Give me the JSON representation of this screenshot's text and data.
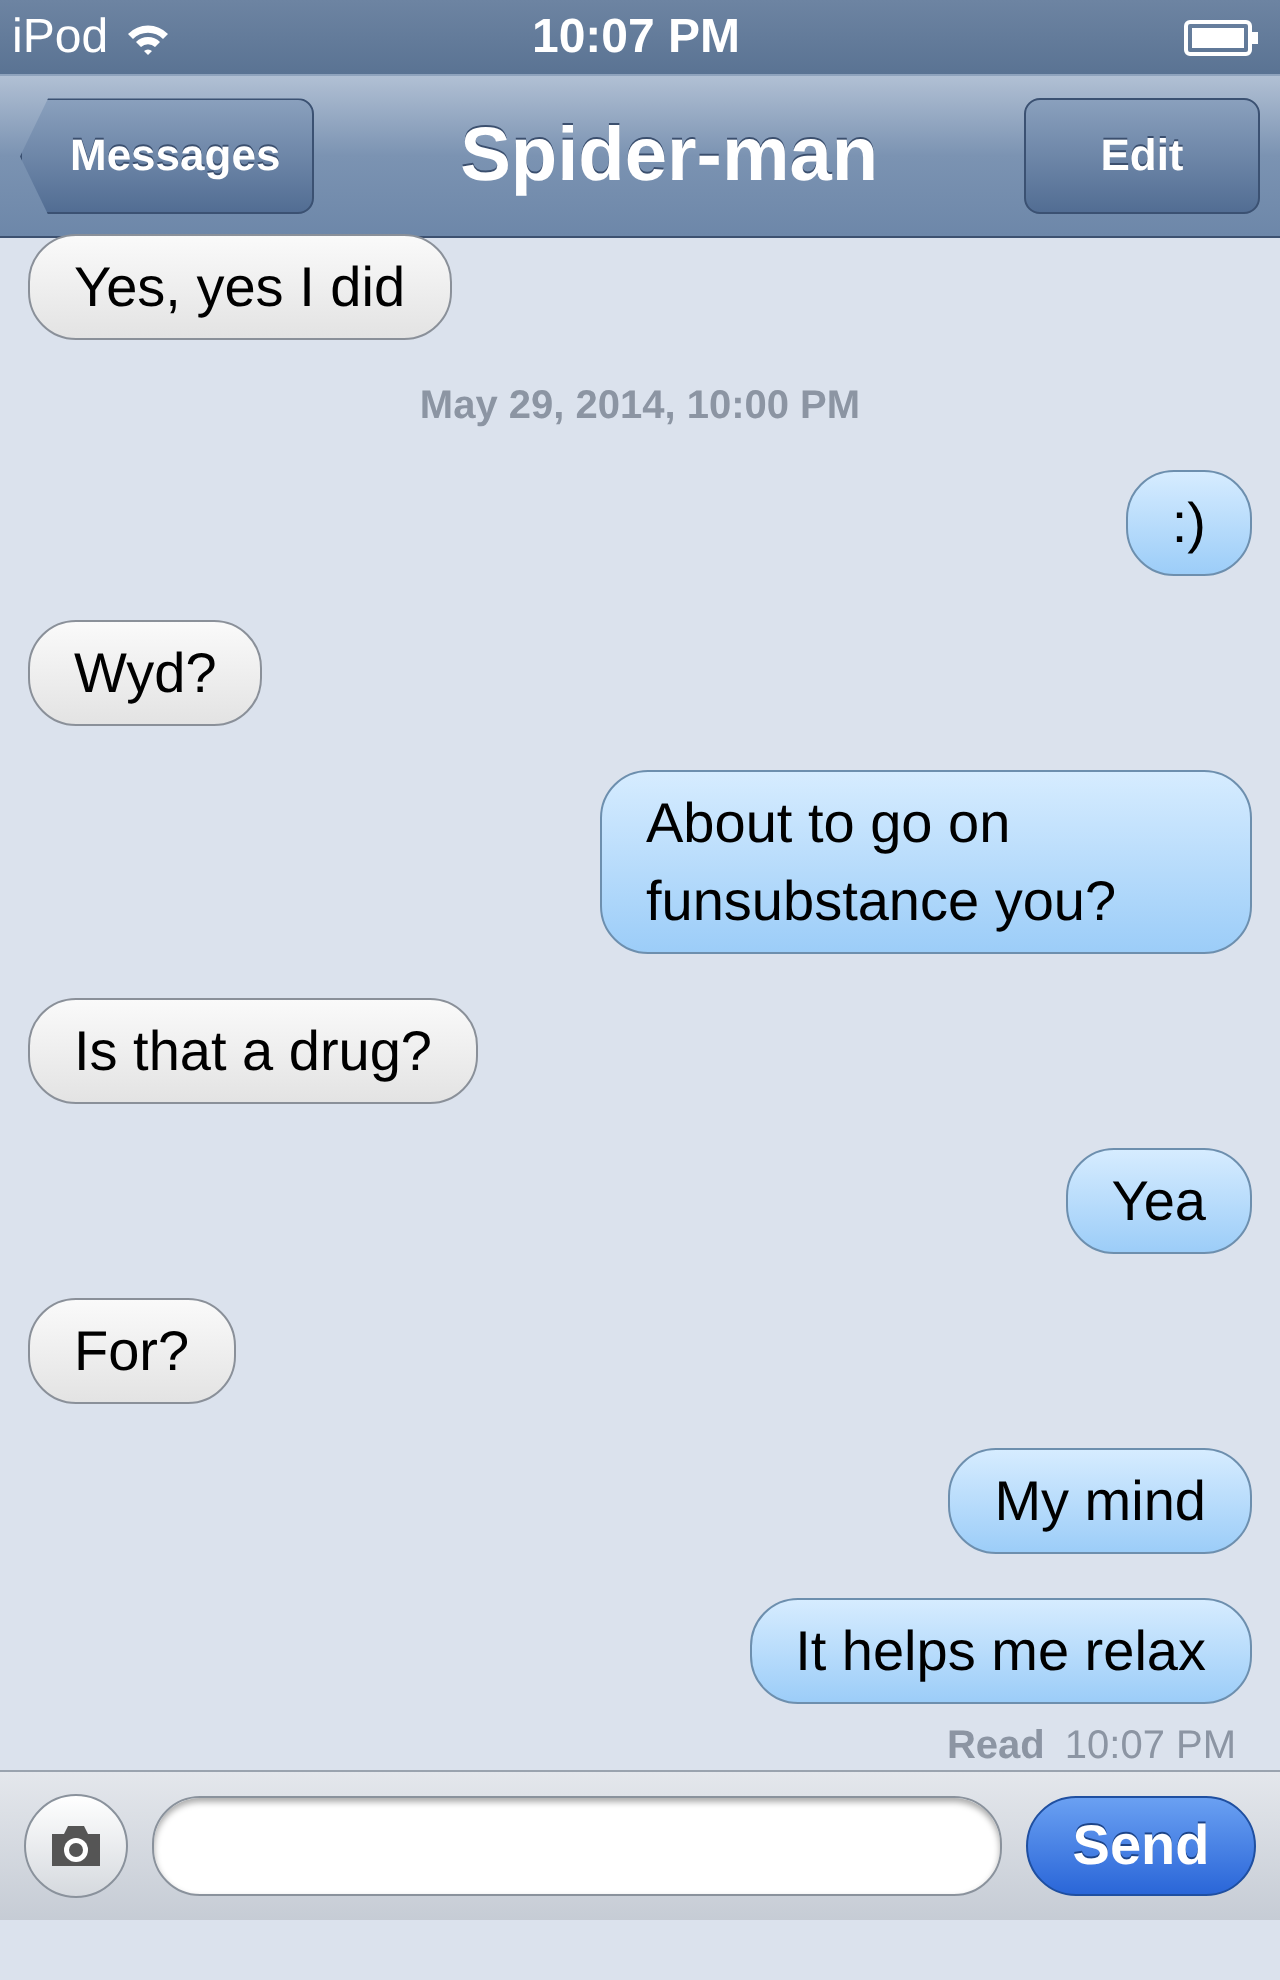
{
  "status_bar": {
    "carrier": "iPod",
    "time": "10:07 PM"
  },
  "nav_bar": {
    "back": "Messages",
    "title": "Spider-man",
    "edit": "Edit"
  },
  "messages": [
    {
      "kind": "message",
      "outgoing": false,
      "text": "Yes, yes I did"
    },
    {
      "kind": "timestamp",
      "text": "May 29, 2014, 10:00 PM"
    },
    {
      "kind": "message",
      "outgoing": true,
      "text": ":)"
    },
    {
      "kind": "message",
      "outgoing": false,
      "text": "Wyd?"
    },
    {
      "kind": "message",
      "outgoing": true,
      "text": "About to go on funsubstance you?"
    },
    {
      "kind": "message",
      "outgoing": false,
      "text": "Is that a drug?"
    },
    {
      "kind": "message",
      "outgoing": true,
      "text": "Yea"
    },
    {
      "kind": "message",
      "outgoing": false,
      "text": "For?"
    },
    {
      "kind": "message",
      "outgoing": true,
      "text": "My mind"
    },
    {
      "kind": "message",
      "outgoing": true,
      "text": "It helps me relax"
    }
  ],
  "receipt": {
    "label": "Read",
    "time": "10:07 PM"
  },
  "composer": {
    "send": "Send"
  }
}
